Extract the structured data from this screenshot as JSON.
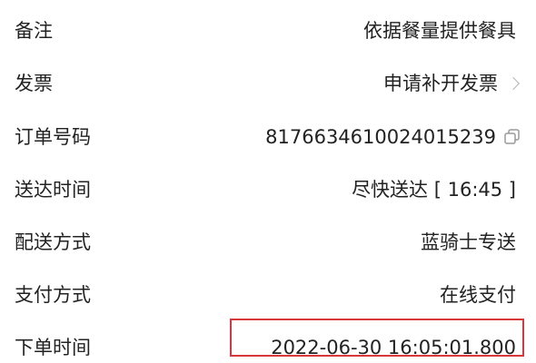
{
  "rows": [
    {
      "label": "备注",
      "value": "依据餐量提供餐具"
    },
    {
      "label": "发票",
      "value": "申请补开发票"
    },
    {
      "label": "订单号码",
      "value": "8176634610024015239"
    },
    {
      "label": "送达时间",
      "value": "尽快送达 [ 16:45 ]"
    },
    {
      "label": "配送方式",
      "value": "蓝骑士专送"
    },
    {
      "label": "支付方式",
      "value": "在线支付"
    },
    {
      "label": "下单时间",
      "value": "2022-06-30 16:05:01.800"
    }
  ],
  "icons": {
    "invoice_chevron": "chevron-right-icon",
    "order_copy": "copy-icon"
  },
  "colors": {
    "highlight_border": "#d9363e",
    "text": "#222222",
    "muted_icon": "#b5b5b5"
  }
}
